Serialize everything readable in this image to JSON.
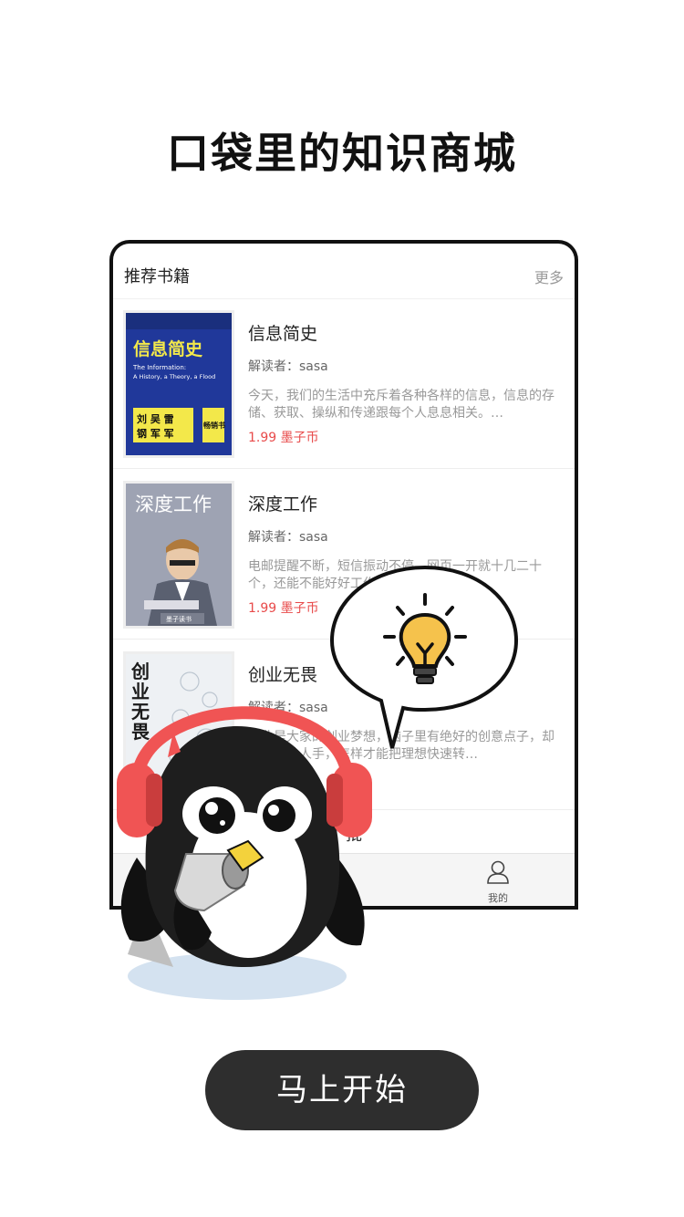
{
  "headline": "口袋里的知识商城",
  "section": {
    "title": "推荐书籍",
    "more": "更多"
  },
  "books": [
    {
      "title": "信息简史",
      "reader": "解读者：sasa",
      "description": "今天，我们的生活中充斥着各种各样的信息，信息的存储、获取、操纵和传递跟每个人息息相关。…",
      "price": "1.99 墨子币",
      "cover_text": [
        "信息简史",
        "The Information:",
        "A History, a Theory, a Flood",
        "刘 吴 雷",
        "钢 军 军",
        "畅销书"
      ]
    },
    {
      "title": "深度工作",
      "reader": "解读者：sasa",
      "description": "电邮提醒不断，短信振动不停，网页一开就十几二十个，还能不能好好工作？ 面对各种科技…",
      "price": "1.99 墨子币",
      "cover_text": [
        "深度工作",
        "墨子读书"
      ]
    },
    {
      "title": "创业无畏",
      "reader": "解读者：sasa",
      "description": "创业是大家的创业梦想，脑子里有绝好的创意点子，却缺钱、缺人手，怎样才能把理想快速转…",
      "price": "",
      "cover_text": [
        "创",
        "业",
        "无",
        "畏"
      ]
    }
  ],
  "partial_row_text": "批",
  "tab_bar": {
    "mine_label": "我的"
  },
  "cta": {
    "label": "马上开始"
  },
  "colors": {
    "price": "#e84a4a",
    "cta_bg": "#2e2e2e",
    "headphones": "#f05454",
    "bulb": "#f5c24c"
  },
  "icons": [
    "user-icon",
    "lightbulb-icon",
    "penguin-mascot"
  ]
}
